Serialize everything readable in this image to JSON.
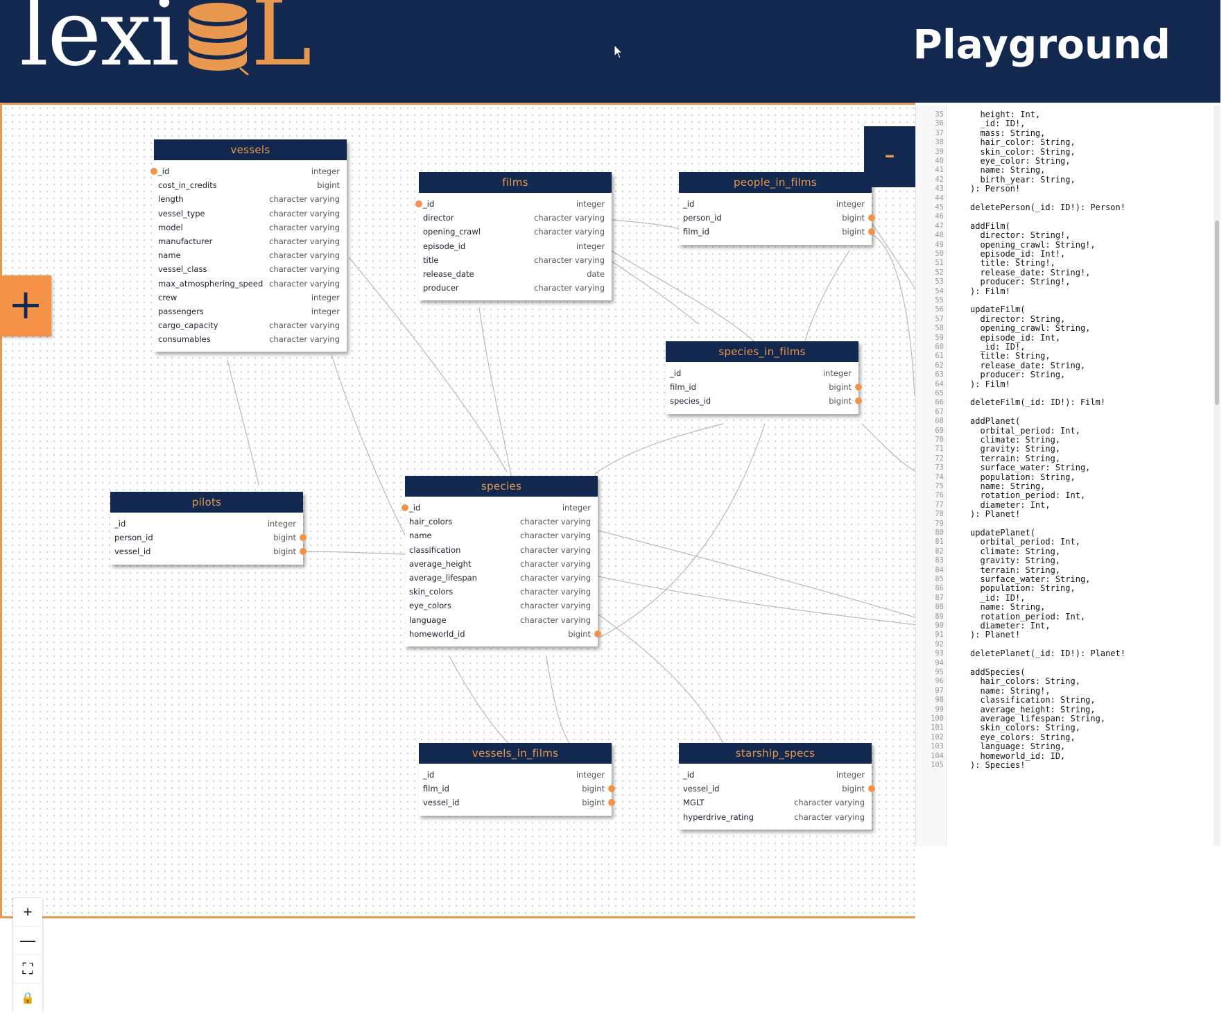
{
  "header": {
    "logo_text": "lexi",
    "logo_accent": "L",
    "title": "Playground"
  },
  "colors": {
    "navy": "#12284e",
    "orange": "#e8994f",
    "connector": "#f5924a"
  },
  "canvas": {
    "add_button": "+",
    "collapse_button": "-",
    "controls": {
      "zoom_in": "+",
      "zoom_out": "—",
      "fit_view": "⛶",
      "lock": "🔒"
    }
  },
  "tables": {
    "vessels": {
      "name": "vessels",
      "rows": [
        {
          "col": "_id",
          "type": "integer"
        },
        {
          "col": "cost_in_credits",
          "type": "bigint"
        },
        {
          "col": "length",
          "type": "character varying"
        },
        {
          "col": "vessel_type",
          "type": "character varying"
        },
        {
          "col": "model",
          "type": "character varying"
        },
        {
          "col": "manufacturer",
          "type": "character varying"
        },
        {
          "col": "name",
          "type": "character varying"
        },
        {
          "col": "vessel_class",
          "type": "character varying"
        },
        {
          "col": "max_atmosphering_speed",
          "type": "character varying"
        },
        {
          "col": "crew",
          "type": "integer"
        },
        {
          "col": "passengers",
          "type": "integer"
        },
        {
          "col": "cargo_capacity",
          "type": "character varying"
        },
        {
          "col": "consumables",
          "type": "character varying"
        }
      ]
    },
    "films": {
      "name": "films",
      "rows": [
        {
          "col": "_id",
          "type": "integer"
        },
        {
          "col": "director",
          "type": "character varying"
        },
        {
          "col": "opening_crawl",
          "type": "character varying"
        },
        {
          "col": "episode_id",
          "type": "integer"
        },
        {
          "col": "title",
          "type": "character varying"
        },
        {
          "col": "release_date",
          "type": "date"
        },
        {
          "col": "producer",
          "type": "character varying"
        }
      ]
    },
    "people_in_films": {
      "name": "people_in_films",
      "rows": [
        {
          "col": "_id",
          "type": "integer"
        },
        {
          "col": "person_id",
          "type": "bigint"
        },
        {
          "col": "film_id",
          "type": "bigint"
        }
      ]
    },
    "species_in_films": {
      "name": "species_in_films",
      "rows": [
        {
          "col": "_id",
          "type": "integer"
        },
        {
          "col": "film_id",
          "type": "bigint"
        },
        {
          "col": "species_id",
          "type": "bigint"
        }
      ]
    },
    "pilots": {
      "name": "pilots",
      "rows": [
        {
          "col": "_id",
          "type": "integer"
        },
        {
          "col": "person_id",
          "type": "bigint"
        },
        {
          "col": "vessel_id",
          "type": "bigint"
        }
      ]
    },
    "species": {
      "name": "species",
      "rows": [
        {
          "col": "_id",
          "type": "integer"
        },
        {
          "col": "hair_colors",
          "type": "character varying"
        },
        {
          "col": "name",
          "type": "character varying"
        },
        {
          "col": "classification",
          "type": "character varying"
        },
        {
          "col": "average_height",
          "type": "character varying"
        },
        {
          "col": "average_lifespan",
          "type": "character varying"
        },
        {
          "col": "skin_colors",
          "type": "character varying"
        },
        {
          "col": "eye_colors",
          "type": "character varying"
        },
        {
          "col": "language",
          "type": "character varying"
        },
        {
          "col": "homeworld_id",
          "type": "bigint"
        }
      ]
    },
    "vessels_in_films": {
      "name": "vessels_in_films",
      "rows": [
        {
          "col": "_id",
          "type": "integer"
        },
        {
          "col": "film_id",
          "type": "bigint"
        },
        {
          "col": "vessel_id",
          "type": "bigint"
        }
      ]
    },
    "starship_specs": {
      "name": "starship_specs",
      "rows": [
        {
          "col": "_id",
          "type": "integer"
        },
        {
          "col": "vessel_id",
          "type": "bigint"
        },
        {
          "col": "MGLT",
          "type": "character varying"
        },
        {
          "col": "hyperdrive_rating",
          "type": "character varying"
        }
      ]
    }
  },
  "editor": {
    "first_line": 35,
    "lines": [
      "  height: Int,",
      "  _id: ID!,",
      "  mass: String,",
      "  hair_color: String,",
      "  skin_color: String,",
      "  eye_color: String,",
      "  name: String,",
      "  birth_year: String,",
      "): Person!",
      "",
      "deletePerson(_id: ID!): Person!",
      "",
      "addFilm(",
      "  director: String!,",
      "  opening_crawl: String!,",
      "  episode_id: Int!,",
      "  title: String!,",
      "  release_date: String!,",
      "  producer: String!,",
      "): Film!",
      "",
      "updateFilm(",
      "  director: String,",
      "  opening_crawl: String,",
      "  episode_id: Int,",
      "  _id: ID!,",
      "  title: String,",
      "  release_date: String,",
      "  producer: String,",
      "): Film!",
      "",
      "deleteFilm(_id: ID!): Film!",
      "",
      "addPlanet(",
      "  orbital_period: Int,",
      "  climate: String,",
      "  gravity: String,",
      "  terrain: String,",
      "  surface_water: String,",
      "  population: String,",
      "  name: String,",
      "  rotation_period: Int,",
      "  diameter: Int,",
      "): Planet!",
      "",
      "updatePlanet(",
      "  orbital_period: Int,",
      "  climate: String,",
      "  gravity: String,",
      "  terrain: String,",
      "  surface_water: String,",
      "  population: String,",
      "  _id: ID!,",
      "  name: String,",
      "  rotation_period: Int,",
      "  diameter: Int,",
      "): Planet!",
      "",
      "deletePlanet(_id: ID!): Planet!",
      "",
      "addSpecies(",
      "  hair_colors: String,",
      "  name: String!,",
      "  classification: String,",
      "  average_height: String,",
      "  average_lifespan: String,",
      "  skin_colors: String,",
      "  eye_colors: String,",
      "  language: String,",
      "  homeworld_id: ID,",
      "): Species!"
    ]
  }
}
